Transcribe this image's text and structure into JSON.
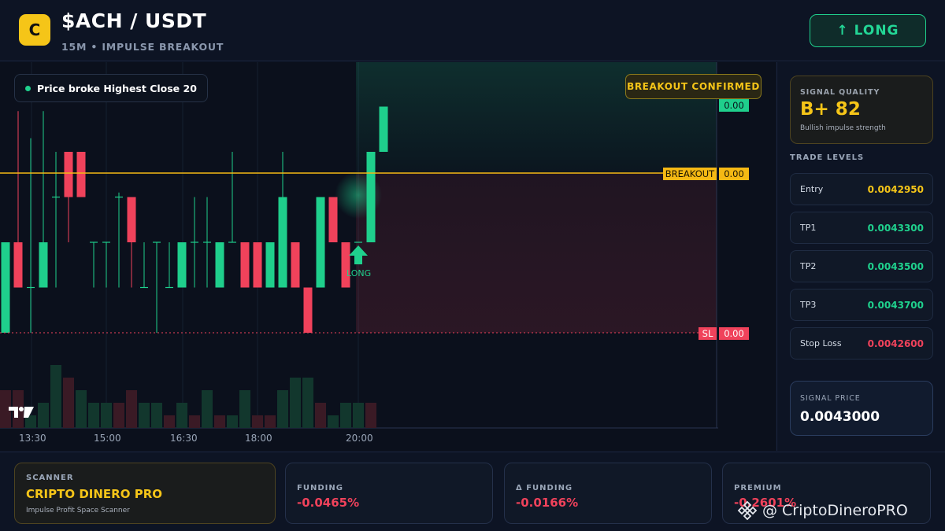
{
  "header": {
    "coin_letter": "C",
    "pair": "$ACH / USDT",
    "subtitle": "15M • IMPULSE BREAKOUT",
    "direction_button": "↑ LONG"
  },
  "chart": {
    "note": "Price broke Highest Close 20",
    "badge": "BREAKOUT CONFIRMED",
    "price_tags": {
      "top": "0.00",
      "breakout_label": "BREAKOUT",
      "breakout_value": "0.00",
      "sl_label": "SL",
      "sl_value": "0.00"
    },
    "long_marker": "LONG",
    "time_labels": [
      "13:30",
      "15:00",
      "16:30",
      "18:00",
      "20:00"
    ],
    "colors": {
      "bull": "#1fcf8c",
      "bear": "#f0425b",
      "breakout_line": "#f5b914"
    }
  },
  "chart_data": {
    "type": "candlestick",
    "x_ticks": [
      "13:30",
      "15:00",
      "16:30",
      "18:00",
      "20:00"
    ],
    "candles": [
      {
        "o": 0.0,
        "c": 1.0,
        "h": 1.0,
        "l": 0.0,
        "d": "bull"
      },
      {
        "o": 1.0,
        "c": 0.5,
        "h": 2.45,
        "l": 0.5,
        "d": "bear"
      },
      {
        "o": 0.5,
        "c": 0.5,
        "h": 2.15,
        "l": 0.0,
        "d": "flat"
      },
      {
        "o": 0.5,
        "c": 1.0,
        "h": 2.45,
        "l": 0.5,
        "d": "bull"
      },
      {
        "o": 1.5,
        "c": 1.5,
        "h": 2.0,
        "l": 0.5,
        "d": "flat"
      },
      {
        "o": 2.0,
        "c": 1.5,
        "h": 2.0,
        "l": 1.0,
        "d": "bear"
      },
      {
        "o": 2.0,
        "c": 1.5,
        "h": 2.0,
        "l": 1.5,
        "d": "bear"
      },
      {
        "o": 1.0,
        "c": 1.0,
        "h": 1.0,
        "l": 0.5,
        "d": "flat"
      },
      {
        "o": 1.0,
        "c": 1.0,
        "h": 1.0,
        "l": 0.5,
        "d": "flat"
      },
      {
        "o": 1.5,
        "c": 1.5,
        "h": 1.55,
        "l": 0.5,
        "d": "flat"
      },
      {
        "o": 1.5,
        "c": 1.0,
        "h": 1.5,
        "l": 0.5,
        "d": "bear"
      },
      {
        "o": 0.5,
        "c": 0.5,
        "h": 1.0,
        "l": 0.5,
        "d": "flat"
      },
      {
        "o": 1.0,
        "c": 1.0,
        "h": 1.0,
        "l": 0.0,
        "d": "flat"
      },
      {
        "o": 0.5,
        "c": 0.5,
        "h": 1.0,
        "l": 0.5,
        "d": "flat"
      },
      {
        "o": 0.5,
        "c": 1.0,
        "h": 1.0,
        "l": 0.5,
        "d": "bull"
      },
      {
        "o": 1.0,
        "c": 1.0,
        "h": 1.5,
        "l": 0.5,
        "d": "flat"
      },
      {
        "o": 1.0,
        "c": 1.0,
        "h": 1.5,
        "l": 0.5,
        "d": "flat"
      },
      {
        "o": 0.5,
        "c": 1.0,
        "h": 1.0,
        "l": 0.5,
        "d": "bull"
      },
      {
        "o": 1.0,
        "c": 1.0,
        "h": 2.0,
        "l": 1.0,
        "d": "flat"
      },
      {
        "o": 1.0,
        "c": 0.5,
        "h": 1.0,
        "l": 0.5,
        "d": "bear"
      },
      {
        "o": 1.0,
        "c": 0.5,
        "h": 1.0,
        "l": 0.5,
        "d": "bear"
      },
      {
        "o": 0.5,
        "c": 1.0,
        "h": 1.0,
        "l": 0.5,
        "d": "bull"
      },
      {
        "o": 0.5,
        "c": 1.5,
        "h": 2.0,
        "l": 0.5,
        "d": "bull"
      },
      {
        "o": 1.0,
        "c": 0.5,
        "h": 1.0,
        "l": 0.5,
        "d": "bear"
      },
      {
        "o": 0.5,
        "c": 0.0,
        "h": 0.5,
        "l": 0.0,
        "d": "bear"
      },
      {
        "o": 0.5,
        "c": 1.5,
        "h": 1.5,
        "l": 0.5,
        "d": "bull"
      },
      {
        "o": 1.5,
        "c": 1.0,
        "h": 1.5,
        "l": 1.0,
        "d": "bear"
      },
      {
        "o": 1.0,
        "c": 0.5,
        "h": 1.0,
        "l": 0.5,
        "d": "bear"
      },
      {
        "o": 1.0,
        "c": 1.0,
        "h": 1.0,
        "l": 1.0,
        "d": "flat"
      },
      {
        "o": 1.0,
        "c": 2.0,
        "h": 2.0,
        "l": 1.0,
        "d": "bull"
      },
      {
        "o": 2.0,
        "c": 2.5,
        "h": 2.5,
        "l": 2.0,
        "d": "bull"
      }
    ],
    "volume": [
      3,
      3,
      1,
      2,
      5,
      4,
      3,
      2,
      2,
      2,
      3,
      2,
      2,
      1,
      2,
      1,
      3,
      1,
      1,
      3,
      1,
      1,
      3,
      4,
      4,
      2,
      1,
      2,
      2,
      2,
      1,
      1,
      2,
      2,
      1,
      2,
      2,
      1,
      2,
      2
    ]
  },
  "trade_panel": {
    "quality_label": "SIGNAL QUALITY",
    "quality_value": "B+ 82",
    "quality_desc": "Bullish impulse strength",
    "levels_title": "TRADE LEVELS",
    "levels": [
      {
        "name": "Entry",
        "value": "0.0042950",
        "color": "#f5c518"
      },
      {
        "name": "TP1",
        "value": "0.0043300",
        "color": "#1fd18d"
      },
      {
        "name": "TP2",
        "value": "0.0043500",
        "color": "#1fd18d"
      },
      {
        "name": "TP3",
        "value": "0.0043700",
        "color": "#1fd18d"
      },
      {
        "name": "Stop Loss",
        "value": "0.0042600",
        "color": "#f0425b"
      }
    ],
    "signal_price_label": "SIGNAL PRICE",
    "signal_price_value": "0.0043000"
  },
  "footer": {
    "scanner_label": "SCANNER",
    "scanner_name": "CRIPTO DINERO PRO",
    "scanner_desc": "Impulse Profit Space Scanner",
    "funding_label": "FUNDING",
    "funding_value": "-0.0465%",
    "delta_funding_label": "Δ FUNDING",
    "delta_funding_value": "-0.0166%",
    "premium_label": "PREMIUM",
    "premium_value": "-0.2601%",
    "watermark": "@ CriptoDineroPRO"
  }
}
